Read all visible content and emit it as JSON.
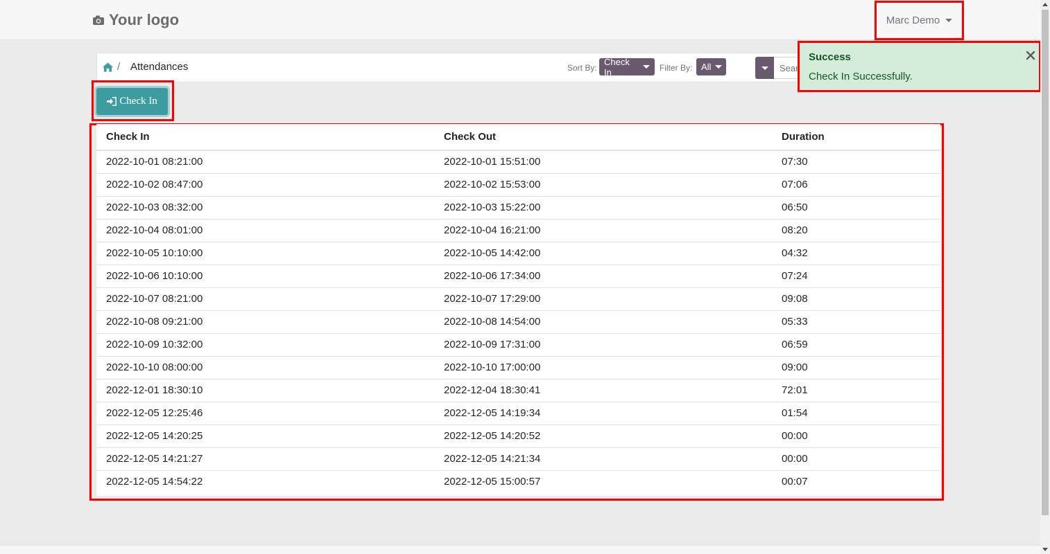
{
  "header": {
    "logo_text": "Your logo",
    "user_name": "Marc Demo"
  },
  "breadcrumb": {
    "current": "Attendances",
    "separator": "/"
  },
  "controls": {
    "sort_label": "Sort By:",
    "sort_value": "Check In",
    "filter_label": "Filter By:",
    "filter_value": "All",
    "search_placeholder": "Search..."
  },
  "checkin_button": {
    "label": "Check In"
  },
  "toast": {
    "title": "Success",
    "message": "Check In Successfully."
  },
  "table": {
    "columns": [
      "Check In",
      "Check Out",
      "Duration"
    ],
    "rows": [
      [
        "2022-10-01 08:21:00",
        "2022-10-01 15:51:00",
        "07:30"
      ],
      [
        "2022-10-02 08:47:00",
        "2022-10-02 15:53:00",
        "07:06"
      ],
      [
        "2022-10-03 08:32:00",
        "2022-10-03 15:22:00",
        "06:50"
      ],
      [
        "2022-10-04 08:01:00",
        "2022-10-04 16:21:00",
        "08:20"
      ],
      [
        "2022-10-05 10:10:00",
        "2022-10-05 14:42:00",
        "04:32"
      ],
      [
        "2022-10-06 10:10:00",
        "2022-10-06 17:34:00",
        "07:24"
      ],
      [
        "2022-10-07 08:21:00",
        "2022-10-07 17:29:00",
        "09:08"
      ],
      [
        "2022-10-08 09:21:00",
        "2022-10-08 14:54:00",
        "05:33"
      ],
      [
        "2022-10-09 10:32:00",
        "2022-10-09 17:31:00",
        "06:59"
      ],
      [
        "2022-10-10 08:00:00",
        "2022-10-10 17:00:00",
        "09:00"
      ],
      [
        "2022-12-01 18:30:10",
        "2022-12-04 18:30:41",
        "72:01"
      ],
      [
        "2022-12-05 12:25:46",
        "2022-12-05 14:19:34",
        "01:54"
      ],
      [
        "2022-12-05 14:20:25",
        "2022-12-05 14:20:52",
        "00:00"
      ],
      [
        "2022-12-05 14:21:27",
        "2022-12-05 14:21:34",
        "00:00"
      ],
      [
        "2022-12-05 14:54:22",
        "2022-12-05 15:00:57",
        "00:07"
      ]
    ]
  },
  "colors": {
    "primary_teal": "#3d9c9f",
    "pill_purple": "#6a5a6f",
    "highlight_red": "#ff0000",
    "toast_bg": "#d4edda"
  },
  "icons": {
    "logo": "camera-icon",
    "home": "home-icon",
    "checkin": "sign-in-icon",
    "close": "close-icon"
  }
}
